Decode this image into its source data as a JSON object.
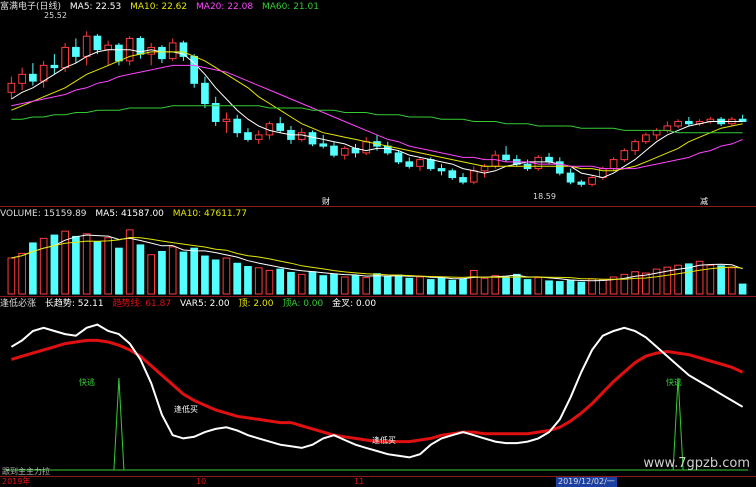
{
  "header_price": {
    "title": "富满电子(日线)",
    "ma5": "MA5: 22.53",
    "ma10": "MA10: 22.62",
    "ma20": "MA20: 22.08",
    "ma60": "MA60: 21.01"
  },
  "header_volume": {
    "title": "VOLUME: 15159.89",
    "ma5": "MA5: 41587.00",
    "ma10": "MA10: 47611.77"
  },
  "header_ind": {
    "title": "逢低必涨",
    "trend": "长趋势: 52.11",
    "t2": "趋势线: 61.87",
    "t3": "VAR5: 2.00",
    "t4": "顶: 2.00",
    "t5": "顶A: 0.00",
    "t6": "金叉: 0.00"
  },
  "annotations": {
    "high": "25.52",
    "low": "18.59",
    "cai": "财",
    "jian": "减",
    "quick1": "快逃",
    "quick2": "快逃",
    "buy1": "逢低买",
    "buy2": "逢低买",
    "main_note": "跟到主主力拉"
  },
  "axis": {
    "d1": "2019年",
    "d2": "10",
    "d3": "11",
    "d4": "2019/12/02/一"
  },
  "watermark": "www.7gpzb.com",
  "colors": {
    "up": "#ff3c3c",
    "down": "#54ffff",
    "ma5": "#ffffff",
    "ma10": "#e6e600",
    "ma20": "#ff44ff",
    "ma60": "#33cc33",
    "trend_white": "#ffffff",
    "trend_red": "#e01010",
    "signal": "#33cc33"
  },
  "chart_data": [
    {
      "type": "candlestick",
      "title": "富满电子(日线)",
      "ylim": [
        18,
        26.2
      ],
      "candles": [
        [
          22.8,
          23.5,
          22.5,
          23.2
        ],
        [
          23.2,
          23.9,
          22.9,
          23.6
        ],
        [
          23.6,
          24.1,
          23.1,
          23.3
        ],
        [
          23.3,
          24.2,
          23.0,
          24.0
        ],
        [
          24.0,
          24.5,
          23.6,
          23.9
        ],
        [
          23.9,
          25.0,
          23.7,
          24.8
        ],
        [
          24.8,
          25.2,
          24.1,
          24.4
        ],
        [
          24.4,
          25.52,
          24.0,
          25.3
        ],
        [
          25.3,
          25.4,
          24.5,
          24.7
        ],
        [
          24.7,
          25.1,
          24.0,
          24.9
        ],
        [
          24.9,
          25.0,
          24.0,
          24.2
        ],
        [
          24.2,
          25.3,
          24.0,
          25.2
        ],
        [
          25.2,
          25.3,
          24.3,
          24.5
        ],
        [
          24.5,
          25.0,
          24.0,
          24.8
        ],
        [
          24.8,
          24.9,
          24.1,
          24.3
        ],
        [
          24.3,
          25.2,
          24.2,
          25.0
        ],
        [
          25.0,
          25.1,
          24.2,
          24.4
        ],
        [
          24.4,
          24.5,
          23.0,
          23.2
        ],
        [
          23.2,
          23.5,
          22.1,
          22.3
        ],
        [
          22.3,
          22.6,
          21.3,
          21.5
        ],
        [
          21.5,
          21.9,
          21.0,
          21.6
        ],
        [
          21.6,
          21.8,
          20.8,
          21.0
        ],
        [
          21.0,
          21.2,
          20.6,
          20.7
        ],
        [
          20.7,
          21.1,
          20.5,
          20.9
        ],
        [
          20.9,
          21.5,
          20.7,
          21.4
        ],
        [
          21.4,
          21.7,
          21.0,
          21.1
        ],
        [
          21.1,
          21.3,
          20.5,
          20.7
        ],
        [
          20.7,
          21.2,
          20.6,
          21.0
        ],
        [
          21.0,
          21.1,
          20.4,
          20.5
        ],
        [
          20.5,
          20.9,
          20.3,
          20.4
        ],
        [
          20.4,
          20.6,
          19.9,
          20.0
        ],
        [
          20.0,
          20.4,
          19.8,
          20.3
        ],
        [
          20.3,
          20.5,
          19.9,
          20.1
        ],
        [
          20.1,
          20.8,
          20.0,
          20.6
        ],
        [
          20.6,
          20.9,
          20.2,
          20.4
        ],
        [
          20.4,
          20.6,
          20.0,
          20.1
        ],
        [
          20.1,
          20.2,
          19.6,
          19.7
        ],
        [
          19.7,
          19.9,
          19.4,
          19.5
        ],
        [
          19.5,
          19.9,
          19.3,
          19.8
        ],
        [
          19.8,
          19.9,
          19.3,
          19.4
        ],
        [
          19.4,
          19.6,
          19.1,
          19.3
        ],
        [
          19.3,
          19.4,
          18.9,
          19.0
        ],
        [
          19.0,
          19.2,
          18.7,
          18.8
        ],
        [
          18.8,
          19.5,
          18.7,
          19.3
        ],
        [
          19.3,
          19.6,
          19.0,
          19.5
        ],
        [
          19.5,
          20.2,
          19.4,
          20.0
        ],
        [
          20.0,
          20.4,
          19.7,
          19.8
        ],
        [
          19.8,
          20.0,
          19.5,
          19.6
        ],
        [
          19.6,
          19.8,
          19.3,
          19.4
        ],
        [
          19.4,
          20.0,
          19.3,
          19.9
        ],
        [
          19.9,
          20.1,
          19.6,
          19.7
        ],
        [
          19.7,
          19.9,
          19.1,
          19.2
        ],
        [
          19.2,
          19.4,
          18.7,
          18.8
        ],
        [
          18.8,
          18.9,
          18.59,
          18.7
        ],
        [
          18.7,
          19.1,
          18.6,
          19.0
        ],
        [
          19.0,
          19.5,
          18.9,
          19.4
        ],
        [
          19.4,
          19.9,
          19.3,
          19.8
        ],
        [
          19.8,
          20.3,
          19.7,
          20.2
        ],
        [
          20.2,
          20.7,
          20.0,
          20.6
        ],
        [
          20.6,
          21.0,
          20.5,
          20.9
        ],
        [
          20.9,
          21.2,
          20.7,
          21.1
        ],
        [
          21.1,
          21.5,
          21.0,
          21.3
        ],
        [
          21.3,
          21.6,
          21.2,
          21.5
        ],
        [
          21.5,
          21.7,
          21.3,
          21.4
        ],
        [
          21.4,
          21.6,
          21.3,
          21.5
        ],
        [
          21.5,
          21.7,
          21.4,
          21.6
        ],
        [
          21.6,
          21.7,
          21.3,
          21.4
        ],
        [
          21.4,
          21.7,
          21.3,
          21.6
        ],
        [
          21.6,
          21.8,
          21.5,
          21.5
        ]
      ],
      "ma5": [
        22.5,
        22.8,
        23.0,
        23.3,
        23.6,
        23.9,
        24.1,
        24.4,
        24.6,
        24.7,
        24.7,
        24.7,
        24.6,
        24.7,
        24.6,
        24.6,
        24.5,
        24.1,
        23.6,
        23.0,
        22.5,
        22.0,
        21.6,
        21.3,
        21.1,
        21.0,
        20.9,
        20.9,
        20.8,
        20.7,
        20.6,
        20.5,
        20.3,
        20.2,
        20.3,
        20.3,
        20.2,
        20.0,
        19.9,
        19.8,
        19.7,
        19.6,
        19.4,
        19.3,
        19.2,
        19.3,
        19.5,
        19.6,
        19.7,
        19.7,
        19.7,
        19.6,
        19.5,
        19.2,
        19.1,
        19.0,
        19.2,
        19.5,
        19.8,
        20.2,
        20.6,
        20.9,
        21.1,
        21.3,
        21.4,
        21.5,
        21.5,
        21.5,
        21.5
      ],
      "ma10": [
        22.0,
        22.2,
        22.4,
        22.6,
        22.8,
        23.0,
        23.3,
        23.6,
        23.8,
        24.0,
        24.2,
        24.4,
        24.5,
        24.6,
        24.6,
        24.6,
        24.6,
        24.4,
        24.2,
        23.9,
        23.6,
        23.3,
        23.0,
        22.6,
        22.3,
        22.0,
        21.7,
        21.4,
        21.2,
        21.0,
        20.9,
        20.8,
        20.7,
        20.6,
        20.5,
        20.4,
        20.3,
        20.2,
        20.1,
        20.0,
        19.9,
        19.8,
        19.7,
        19.6,
        19.5,
        19.5,
        19.5,
        19.5,
        19.5,
        19.5,
        19.5,
        19.5,
        19.5,
        19.4,
        19.4,
        19.3,
        19.3,
        19.4,
        19.5,
        19.7,
        19.9,
        20.1,
        20.3,
        20.6,
        20.8,
        21.0,
        21.2,
        21.3,
        21.4
      ],
      "ma20": [
        22.2,
        22.3,
        22.4,
        22.5,
        22.6,
        22.7,
        22.9,
        23.0,
        23.2,
        23.3,
        23.5,
        23.6,
        23.7,
        23.8,
        23.9,
        24.0,
        24.0,
        24.0,
        23.9,
        23.8,
        23.7,
        23.5,
        23.3,
        23.1,
        22.9,
        22.7,
        22.5,
        22.3,
        22.1,
        21.9,
        21.7,
        21.5,
        21.3,
        21.1,
        20.9,
        20.7,
        20.6,
        20.4,
        20.3,
        20.2,
        20.1,
        20.0,
        19.9,
        19.9,
        19.8,
        19.8,
        19.7,
        19.7,
        19.7,
        19.6,
        19.6,
        19.6,
        19.5,
        19.5,
        19.5,
        19.4,
        19.4,
        19.4,
        19.4,
        19.5,
        19.6,
        19.7,
        19.8,
        19.9,
        20.1,
        20.2,
        20.4,
        20.5,
        20.7
      ],
      "ma60": [
        21.6,
        21.6,
        21.7,
        21.7,
        21.8,
        21.8,
        21.9,
        21.9,
        22.0,
        22.0,
        22.0,
        22.1,
        22.1,
        22.1,
        22.1,
        22.2,
        22.2,
        22.2,
        22.2,
        22.2,
        22.2,
        22.2,
        22.2,
        22.2,
        22.1,
        22.1,
        22.1,
        22.1,
        22.0,
        22.0,
        22.0,
        21.9,
        21.9,
        21.9,
        21.8,
        21.8,
        21.8,
        21.7,
        21.7,
        21.7,
        21.6,
        21.6,
        21.6,
        21.5,
        21.5,
        21.5,
        21.4,
        21.4,
        21.4,
        21.3,
        21.3,
        21.3,
        21.3,
        21.2,
        21.2,
        21.2,
        21.2,
        21.1,
        21.1,
        21.1,
        21.1,
        21.1,
        21.0,
        21.0,
        21.0,
        21.0,
        21.0,
        21.0,
        21.0
      ]
    },
    {
      "type": "bar",
      "title": "VOLUME",
      "ylim": [
        0,
        110000
      ],
      "values": [
        55000,
        62000,
        78000,
        85000,
        90000,
        96000,
        88000,
        92000,
        80000,
        86000,
        70000,
        98000,
        75000,
        60000,
        65000,
        72000,
        64000,
        70000,
        58000,
        52000,
        55000,
        47000,
        42000,
        40000,
        36000,
        38000,
        33000,
        30000,
        34000,
        28000,
        30000,
        26000,
        28000,
        25000,
        31000,
        27000,
        29000,
        24000,
        26000,
        22000,
        25000,
        21000,
        23000,
        36000,
        24000,
        28000,
        26000,
        30000,
        22000,
        25000,
        20000,
        19000,
        21000,
        18000,
        23000,
        22000,
        26000,
        30000,
        34000,
        32000,
        38000,
        41000,
        44000,
        46000,
        50000,
        44000,
        43000,
        40000,
        15159.89
      ],
      "ma5": [],
      "ma10": []
    },
    {
      "type": "line",
      "title": "逢低必涨",
      "ylim": [
        0,
        100
      ],
      "series": [
        {
          "name": "长趋势",
          "values": [
            78,
            82,
            88,
            90,
            88,
            86,
            85,
            90,
            92,
            88,
            86,
            80,
            70,
            55,
            35,
            22,
            20,
            21,
            24,
            26,
            27,
            25,
            22,
            20,
            18,
            16,
            15,
            14,
            16,
            20,
            22,
            19,
            16,
            14,
            12,
            10,
            9,
            8,
            10,
            16,
            20,
            22,
            24,
            22,
            20,
            18,
            17,
            17,
            18,
            20,
            24,
            32,
            46,
            62,
            76,
            85,
            88,
            90,
            88,
            84,
            78,
            72,
            66,
            60,
            56,
            52,
            48,
            44,
            40
          ]
        },
        {
          "name": "趋势线",
          "values": [
            70,
            72,
            74,
            76,
            78,
            80,
            81,
            82,
            82,
            81,
            79,
            76,
            72,
            66,
            60,
            54,
            48,
            44,
            41,
            38,
            36,
            34,
            33,
            32,
            31,
            30,
            30,
            28,
            26,
            24,
            22,
            21,
            20,
            19,
            18,
            18,
            18,
            18,
            19,
            20,
            22,
            23,
            24,
            24,
            23,
            23,
            23,
            23,
            23,
            24,
            25,
            27,
            31,
            36,
            42,
            49,
            56,
            62,
            68,
            72,
            74,
            75,
            74,
            73,
            71,
            69,
            67,
            65,
            61.87
          ]
        }
      ]
    }
  ]
}
